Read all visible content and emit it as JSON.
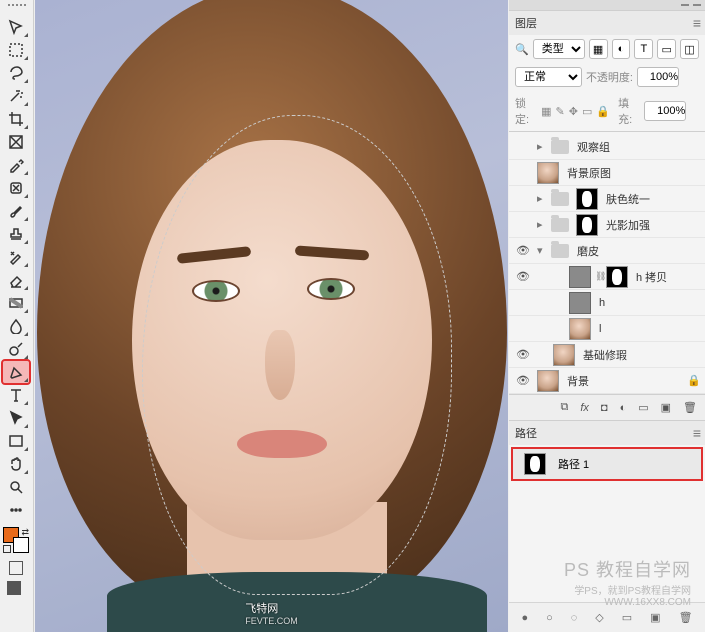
{
  "tools": {
    "list": [
      "move",
      "marquee",
      "lasso",
      "wand",
      "crop",
      "frame",
      "eyedrop",
      "patch",
      "brush",
      "stamp",
      "history",
      "eraser",
      "gradient",
      "blur",
      "dodge",
      "pen",
      "type",
      "path-sel",
      "rect",
      "hand",
      "zoom"
    ],
    "selected": "pen",
    "fg_color": "#e86a1a",
    "bg_color": "#ffffff"
  },
  "watermark_canvas": {
    "title": "飞特网",
    "sub": "FEVTE.COM"
  },
  "watermark_bg": {
    "title": "PS 教程自学网",
    "sub1": "学PS，就到PS教程自学网",
    "sub2": "WWW.16XX8.COM"
  },
  "layers_panel": {
    "title": "图层",
    "filter_kind": "类型",
    "blend_mode": "正常",
    "opacity_label": "不透明度:",
    "opacity_value": "100%",
    "lock_label": "锁定:",
    "fill_label": "填充:",
    "fill_value": "100%",
    "items": [
      {
        "vis": false,
        "type": "group",
        "name": "观察组"
      },
      {
        "vis": false,
        "type": "photo",
        "name": "背景原图"
      },
      {
        "vis": false,
        "type": "group",
        "hasMask": true,
        "name": "肤色统一"
      },
      {
        "vis": false,
        "type": "group",
        "hasMask": true,
        "name": "光影加强"
      },
      {
        "vis": true,
        "type": "group",
        "open": true,
        "name": "磨皮"
      },
      {
        "vis": true,
        "type": "gray",
        "hasMask": true,
        "indent": 2,
        "name": "h 拷贝"
      },
      {
        "vis": false,
        "type": "gray",
        "indent": 2,
        "name": "h"
      },
      {
        "vis": false,
        "type": "photo",
        "indent": 2,
        "name": "l"
      },
      {
        "vis": true,
        "type": "photo",
        "indent": 1,
        "name": "基础修瑕"
      },
      {
        "vis": true,
        "type": "photo",
        "name": "背景",
        "locked": true
      }
    ]
  },
  "paths_panel": {
    "title": "路径",
    "item": "路径 1"
  }
}
